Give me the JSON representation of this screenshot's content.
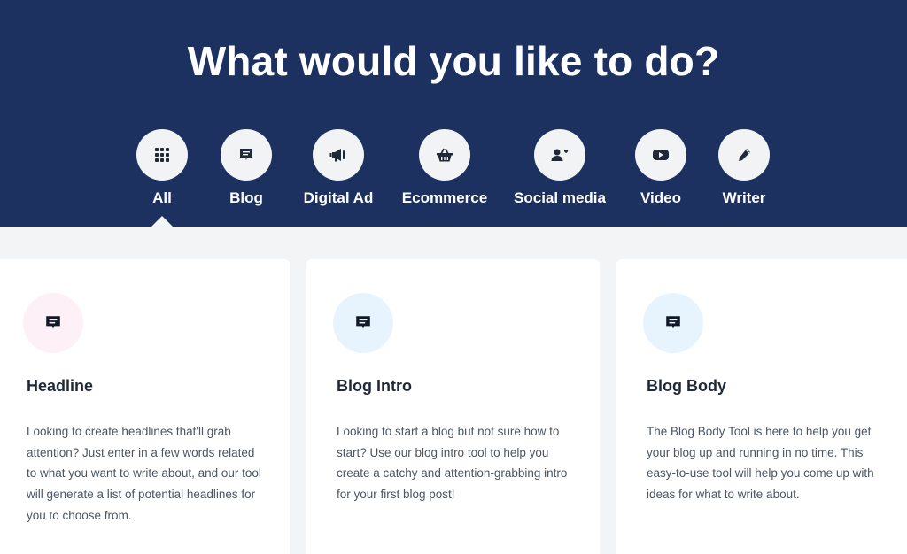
{
  "header": {
    "title": "What would you like to do?"
  },
  "categories": [
    {
      "label": "All",
      "icon": "grid-icon"
    },
    {
      "label": "Blog",
      "icon": "message-icon"
    },
    {
      "label": "Digital Ad",
      "icon": "megaphone-icon"
    },
    {
      "label": "Ecommerce",
      "icon": "basket-icon"
    },
    {
      "label": "Social media",
      "icon": "users-heart-icon"
    },
    {
      "label": "Video",
      "icon": "youtube-icon"
    },
    {
      "label": "Writer",
      "icon": "pencil-icon"
    }
  ],
  "selected_category": "All",
  "cards": [
    {
      "title": "Headline",
      "description": "Looking to create headlines that'll grab attention? Just enter in a few words related to what you want to write about, and our tool will generate a list of potential headlines for you to choose from.",
      "icon": "message-icon",
      "icon_bg": "#fdf0f6"
    },
    {
      "title": "Blog Intro",
      "description": "Looking to start a blog but not sure how to start? Use our blog intro tool to help you create a catchy and attention-grabbing intro for your first blog post!",
      "icon": "message-icon",
      "icon_bg": "#e8f4fd"
    },
    {
      "title": "Blog Body",
      "description": "The Blog Body Tool is here to help you get your blog up and running in no time. This easy-to-use tool will help you come up with ideas for what to write about.",
      "icon": "message-icon",
      "icon_bg": "#e8f4fd"
    }
  ],
  "colors": {
    "header_bg": "#1d3160",
    "page_bg": "#f3f4f6",
    "card_bg": "#ffffff",
    "icon_circle_bg": "#f1f3f5"
  }
}
